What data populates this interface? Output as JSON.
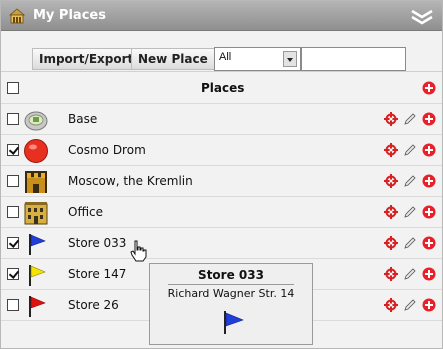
{
  "window": {
    "title": "My Places"
  },
  "toolbar": {
    "import_export_label": "Import/Export",
    "new_place_label": "New Place",
    "filter_value": "All",
    "search_value": ""
  },
  "list": {
    "header": "Places",
    "items": [
      {
        "label": "Base",
        "checked": false,
        "icon": "base-icon"
      },
      {
        "label": "Cosmo Drom",
        "checked": true,
        "icon": "red-circle-icon"
      },
      {
        "label": "Moscow, the Kremlin",
        "checked": false,
        "icon": "castle-icon"
      },
      {
        "label": "Office",
        "checked": false,
        "icon": "building-icon"
      },
      {
        "label": "Store 033",
        "checked": true,
        "icon": "blue-flag-icon"
      },
      {
        "label": "Store 147",
        "checked": true,
        "icon": "yellow-flag-icon"
      },
      {
        "label": "Store 26",
        "checked": false,
        "icon": "red-flag-icon"
      }
    ]
  },
  "tooltip": {
    "title": "Store 033",
    "address": "Richard Wagner Str. 14",
    "icon": "blue-flag-icon"
  },
  "colors": {
    "titlebar": "#9f9f9f",
    "delete_red": "#e8202a",
    "blue_flag": "#1f3fd8",
    "yellow_flag": "#f5e400",
    "red_flag": "#e01010"
  }
}
